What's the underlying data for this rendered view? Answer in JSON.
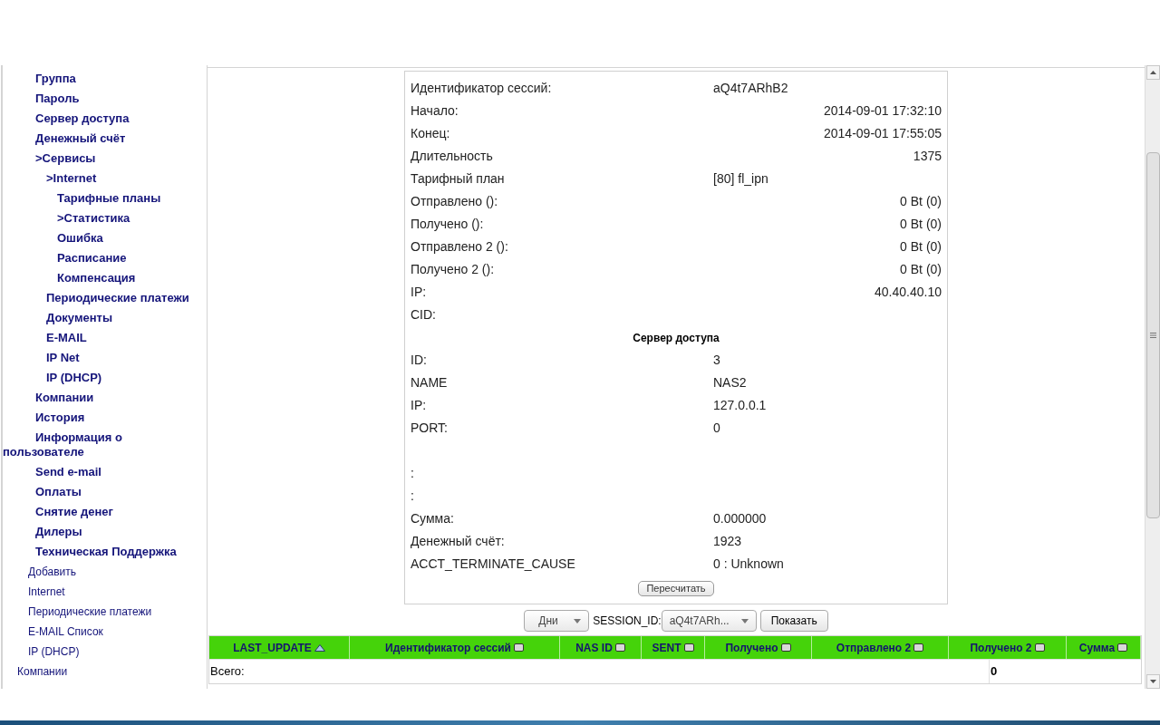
{
  "sidebar": {
    "user_menu": [
      {
        "label": "Группа"
      },
      {
        "label": "Пароль"
      },
      {
        "label": "Сервер доступа"
      },
      {
        "label": "Денежный счёт"
      },
      {
        "label": ">Сервисы",
        "children": [
          {
            "label": ">Internet",
            "children": [
              {
                "label": "Тарифные планы"
              },
              {
                "label": ">Статистика"
              },
              {
                "label": "Ошибка"
              },
              {
                "label": "Расписание"
              },
              {
                "label": "Компенсация"
              }
            ]
          },
          {
            "label": "Периодические платежи"
          },
          {
            "label": "Документы"
          },
          {
            "label": "E-MAIL"
          },
          {
            "label": "IP Net"
          },
          {
            "label": "IP (DHCP)"
          }
        ]
      },
      {
        "label": "Компании"
      },
      {
        "label": "История"
      },
      {
        "label": "Информация о пользователе"
      },
      {
        "label": "Send e-mail"
      },
      {
        "label": "Оплаты"
      },
      {
        "label": "Снятие денег"
      },
      {
        "label": "Дилеры"
      },
      {
        "label": "Техническая Поддержка"
      }
    ],
    "section_menu": [
      {
        "label": "Добавить"
      },
      {
        "label": "Internet"
      },
      {
        "label": "Периодические платежи"
      },
      {
        "label": "E-MAIL Список"
      },
      {
        "label": "IP (DHCP)"
      }
    ],
    "main_menu": [
      {
        "label": "Компании"
      }
    ]
  },
  "session": {
    "rows": [
      {
        "kind": "field",
        "label": "Идентификатор сессий:",
        "value": "aQ4t7ARhB2",
        "right_aligned": false
      },
      {
        "kind": "field",
        "label": "Начало:",
        "value": "2014-09-01 17:32:10",
        "right_aligned": true
      },
      {
        "kind": "field",
        "label": "Конец:",
        "value": "2014-09-01 17:55:05",
        "right_aligned": true
      },
      {
        "kind": "field",
        "label": "Длительность",
        "value": "1375",
        "right_aligned": true
      },
      {
        "kind": "field",
        "label": "Тарифный план",
        "value": "[80] fl_ipn",
        "right_aligned": false
      },
      {
        "kind": "field",
        "label": "Отправлено ():",
        "value": "0 Bt (0)",
        "right_aligned": true
      },
      {
        "kind": "field",
        "label": "Получено ():",
        "value": "0 Bt (0)",
        "right_aligned": true
      },
      {
        "kind": "field",
        "label": "Отправлено 2 ():",
        "value": "0 Bt (0)",
        "right_aligned": true
      },
      {
        "kind": "field",
        "label": "Получено 2 ():",
        "value": "0 Bt (0)",
        "right_aligned": true
      },
      {
        "kind": "field",
        "label": "IP:",
        "value": "40.40.40.10",
        "right_aligned": true
      },
      {
        "kind": "field",
        "label": "CID:"
      },
      {
        "kind": "heading",
        "label": "Сервер доступа"
      },
      {
        "kind": "field",
        "label": "ID:",
        "value": "3",
        "right_aligned": false
      },
      {
        "kind": "field",
        "label": "NAME",
        "value": "NAS2",
        "right_aligned": false
      },
      {
        "kind": "field",
        "label": "IP:",
        "value": "127.0.0.1",
        "right_aligned": false
      },
      {
        "kind": "field",
        "label": "PORT:",
        "value": "0",
        "right_aligned": false
      },
      {
        "kind": "blank"
      },
      {
        "kind": "field",
        "label": ":"
      },
      {
        "kind": "field",
        "label": ":"
      },
      {
        "kind": "field",
        "label": "Сумма:",
        "value": "0.000000",
        "right_aligned": false
      },
      {
        "kind": "field",
        "label": "Денежный счёт:",
        "value": "1923",
        "right_aligned": false
      },
      {
        "kind": "field",
        "label": "ACCT_TERMINATE_CAUSE",
        "value": "0 : Unknown",
        "right_aligned": false
      }
    ],
    "recalc_button": "Пересчитать"
  },
  "filter": {
    "period": "Дни",
    "session_label": "SESSION_ID:",
    "session_value": "aQ4t7ARh...",
    "show_button": "Показать"
  },
  "table": {
    "columns": [
      {
        "label": "LAST_UPDATE",
        "sorted": true
      },
      {
        "label": "Идентификатор сессий",
        "sorted": false
      },
      {
        "label": "NAS ID",
        "sorted": false
      },
      {
        "label": "SENT",
        "sorted": false
      },
      {
        "label": "Получено",
        "sorted": false
      },
      {
        "label": "Отправлено 2",
        "sorted": false
      },
      {
        "label": "Получено 2",
        "sorted": false
      },
      {
        "label": "Сумма",
        "sorted": false
      }
    ],
    "total_row": {
      "label": "Всего:",
      "received_2": "0"
    }
  }
}
